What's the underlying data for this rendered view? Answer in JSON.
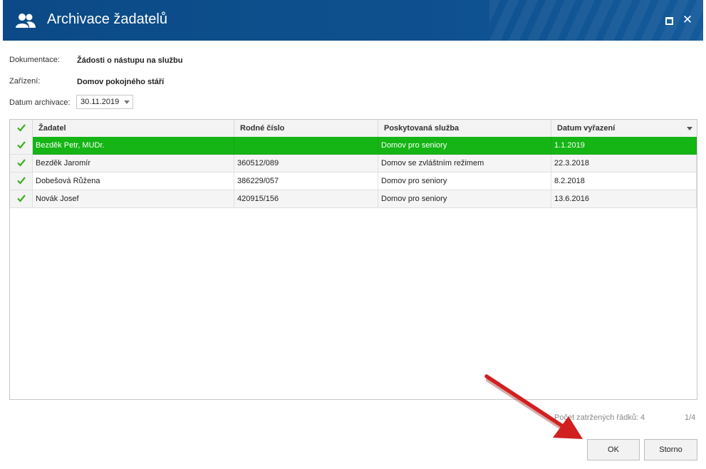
{
  "window": {
    "title": "Archivace žadatelů",
    "icon": "users-icon",
    "controls": [
      "maximize-icon",
      "close-icon"
    ]
  },
  "form": {
    "documentation_label": "Dokumentace:",
    "documentation_value": "Žádosti o nástupu na službu",
    "facility_label": "Zařízení:",
    "facility_value": "Domov pokojného stáří",
    "archive_date_label": "Datum archivace:",
    "archive_date_value": "30.11.2019"
  },
  "table": {
    "columns": [
      "Žadatel",
      "Rodné číslo",
      "Poskytovaná služba",
      "Datum vyřazení"
    ],
    "rows": [
      {
        "checked": true,
        "applicant": "Bezděk Petr, MUDr.",
        "birth_number": "",
        "service": "Domov pro seniory",
        "discharge_date": "1.1.2019",
        "selected": true
      },
      {
        "checked": true,
        "applicant": "Bezděk Jaromír",
        "birth_number": "360512/089",
        "service": "Domov se zvláštním režimem",
        "discharge_date": "22.3.2018"
      },
      {
        "checked": true,
        "applicant": "Dobešová Růžena",
        "birth_number": "386229/057",
        "service": "Domov pro seniory",
        "discharge_date": "8.2.2018"
      },
      {
        "checked": true,
        "applicant": "Novák Josef",
        "birth_number": "420915/156",
        "service": "Domov pro seniory",
        "discharge_date": "13.6.2016"
      }
    ]
  },
  "footer": {
    "checked_count": "Počet zatržených řádků: 4",
    "page_indicator": "1/4"
  },
  "buttons": {
    "ok": "OK",
    "cancel": "Storno"
  },
  "colors": {
    "titlebar": "#0e4f8c",
    "selected_row": "#14b514",
    "check": "#3cae1e",
    "annotation_arrow": "#d21f1f"
  }
}
